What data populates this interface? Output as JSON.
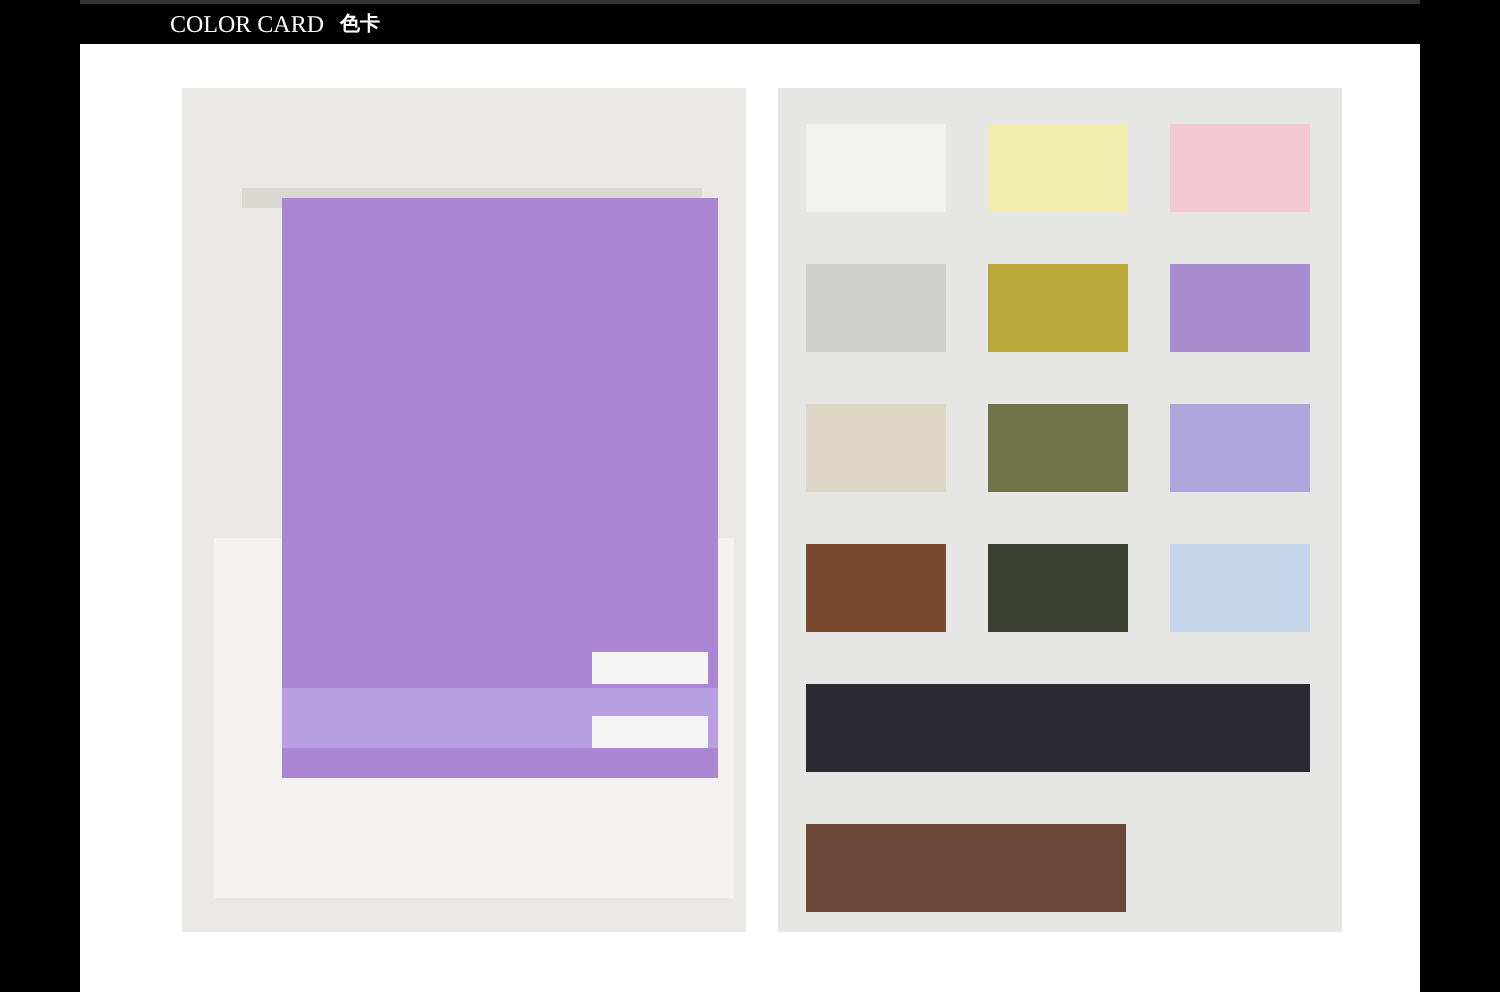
{
  "header": {
    "title": "COLOR CARD",
    "subtitle": "色卡"
  }
}
